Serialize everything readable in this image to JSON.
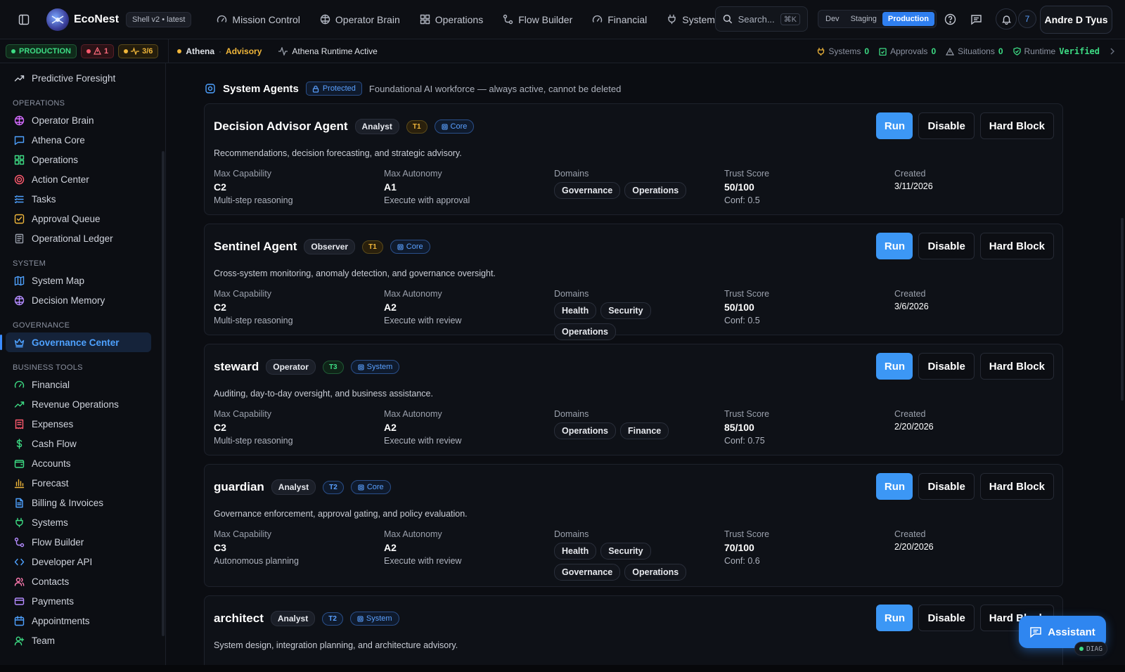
{
  "topbar": {
    "brand": "EcoNest",
    "shell_badge": "Shell v2 • latest",
    "nav": [
      {
        "label": "Mission Control",
        "icon": "gauge-icon"
      },
      {
        "label": "Operator Brain",
        "icon": "brain-icon"
      },
      {
        "label": "Operations",
        "icon": "grid-icon"
      },
      {
        "label": "Flow Builder",
        "icon": "workflow-icon"
      },
      {
        "label": "Financial",
        "icon": "gauge-icon"
      },
      {
        "label": "Systems",
        "icon": "plug-icon"
      }
    ],
    "search_placeholder": "Search...",
    "search_shortcut": "⌘K",
    "env": [
      "Dev",
      "Staging",
      "Production"
    ],
    "env_active": "Production",
    "notification_count": "7",
    "user": "Andre D Tyus"
  },
  "subbar": {
    "env_chip": "PRODUCTION",
    "alerts": "1",
    "score": "3/6",
    "athena": "Athena",
    "mode": "Advisory",
    "runtime_label": "Athena Runtime Active",
    "systems_label": "Systems",
    "systems_count": "0",
    "approvals_label": "Approvals",
    "approvals_count": "0",
    "situations_label": "Situations",
    "situations_count": "0",
    "runtime": "Runtime",
    "runtime_status": "Verified"
  },
  "sidebar": {
    "top_item": {
      "label": "Predictive Foresight",
      "icon": "trend-icon",
      "color": "#cfd3dc"
    },
    "sections": [
      {
        "title": "OPERATIONS",
        "items": [
          {
            "label": "Operator Brain",
            "icon": "brain-icon",
            "color": "#d56bff"
          },
          {
            "label": "Athena Core",
            "icon": "chat-icon",
            "color": "#4ea1ff"
          },
          {
            "label": "Operations",
            "icon": "grid-icon",
            "color": "#3ddc84"
          },
          {
            "label": "Action Center",
            "icon": "target-icon",
            "color": "#ff5a6e"
          },
          {
            "label": "Tasks",
            "icon": "list-icon",
            "color": "#4ea1ff"
          },
          {
            "label": "Approval Queue",
            "icon": "check-square-icon",
            "color": "#f0b63a"
          },
          {
            "label": "Operational Ledger",
            "icon": "ledger-icon",
            "color": "#9aa0ac"
          }
        ]
      },
      {
        "title": "SYSTEM",
        "items": [
          {
            "label": "System Map",
            "icon": "map-icon",
            "color": "#4ea1ff"
          },
          {
            "label": "Decision Memory",
            "icon": "brain-icon",
            "color": "#b48bff"
          }
        ]
      },
      {
        "title": "GOVERNANCE",
        "items": [
          {
            "label": "Governance Center",
            "icon": "crown-icon",
            "color": "#4ea1ff",
            "active": true
          }
        ]
      },
      {
        "title": "BUSINESS TOOLS",
        "items": [
          {
            "label": "Financial",
            "icon": "gauge-icon",
            "color": "#3ddc84"
          },
          {
            "label": "Revenue Operations",
            "icon": "trend-icon",
            "color": "#3ddc84"
          },
          {
            "label": "Expenses",
            "icon": "receipt-icon",
            "color": "#ff5a6e"
          },
          {
            "label": "Cash Flow",
            "icon": "dollar-icon",
            "color": "#3ddc84"
          },
          {
            "label": "Accounts",
            "icon": "wallet-icon",
            "color": "#3ddc84"
          },
          {
            "label": "Forecast",
            "icon": "bar-chart-icon",
            "color": "#f0b63a"
          },
          {
            "label": "Billing & Invoices",
            "icon": "file-icon",
            "color": "#4ea1ff"
          },
          {
            "label": "Systems",
            "icon": "plug-icon",
            "color": "#3ddc84"
          },
          {
            "label": "Flow Builder",
            "icon": "workflow-icon",
            "color": "#b48bff"
          },
          {
            "label": "Developer API",
            "icon": "code-icon",
            "color": "#4ea1ff"
          },
          {
            "label": "Contacts",
            "icon": "users-icon",
            "color": "#ff7ab0"
          },
          {
            "label": "Payments",
            "icon": "card-icon",
            "color": "#b48bff"
          },
          {
            "label": "Appointments",
            "icon": "calendar-icon",
            "color": "#4ea1ff"
          },
          {
            "label": "Team",
            "icon": "user-plus-icon",
            "color": "#3ddc84"
          }
        ]
      }
    ]
  },
  "main": {
    "section_title": "System Agents",
    "protected_label": "Protected",
    "section_sub": "Foundational AI workforce — always active, cannot be deleted",
    "labels": {
      "max_capability": "Max Capability",
      "max_autonomy": "Max Autonomy",
      "domains": "Domains",
      "trust_score": "Trust Score",
      "created": "Created"
    },
    "actions": {
      "run": "Run",
      "disable": "Disable",
      "hard_block": "Hard Block"
    },
    "agents": [
      {
        "name": "Decision Advisor Agent",
        "role": "Analyst",
        "tier": "T1",
        "kind": "Core",
        "description": "Recommendations, decision forecasting, and strategic advisory.",
        "capability": "C2",
        "capability_desc": "Multi-step reasoning",
        "autonomy": "A1",
        "autonomy_desc": "Execute with approval",
        "domains": [
          "Governance",
          "Operations"
        ],
        "trust": "50/100",
        "conf": "Conf: 0.5",
        "created": "3/11/2026"
      },
      {
        "name": "Sentinel Agent",
        "role": "Observer",
        "tier": "T1",
        "kind": "Core",
        "description": "Cross-system monitoring, anomaly detection, and governance oversight.",
        "capability": "C2",
        "capability_desc": "Multi-step reasoning",
        "autonomy": "A2",
        "autonomy_desc": "Execute with review",
        "domains": [
          "Health",
          "Security",
          "Operations"
        ],
        "trust": "50/100",
        "conf": "Conf: 0.5",
        "created": "3/6/2026"
      },
      {
        "name": "steward",
        "role": "Operator",
        "tier": "T3",
        "kind": "System",
        "description": "Auditing, day-to-day oversight, and business assistance.",
        "capability": "C2",
        "capability_desc": "Multi-step reasoning",
        "autonomy": "A2",
        "autonomy_desc": "Execute with review",
        "domains": [
          "Operations",
          "Finance"
        ],
        "trust": "85/100",
        "conf": "Conf: 0.75",
        "created": "2/20/2026"
      },
      {
        "name": "guardian",
        "role": "Analyst",
        "tier": "T2",
        "kind": "Core",
        "description": "Governance enforcement, approval gating, and policy evaluation.",
        "capability": "C3",
        "capability_desc": "Autonomous planning",
        "autonomy": "A2",
        "autonomy_desc": "Execute with review",
        "domains": [
          "Health",
          "Security",
          "Governance",
          "Operations"
        ],
        "trust": "70/100",
        "conf": "Conf: 0.6",
        "created": "2/20/2026"
      },
      {
        "name": "architect",
        "role": "Analyst",
        "tier": "T2",
        "kind": "System",
        "description": "System design, integration planning, and architecture advisory.",
        "capability": "",
        "capability_desc": "",
        "autonomy": "",
        "autonomy_desc": "",
        "domains": [],
        "trust": "",
        "conf": "",
        "created": ""
      }
    ]
  },
  "floating": {
    "assistant": "Assistant",
    "diag": "DIAG"
  }
}
